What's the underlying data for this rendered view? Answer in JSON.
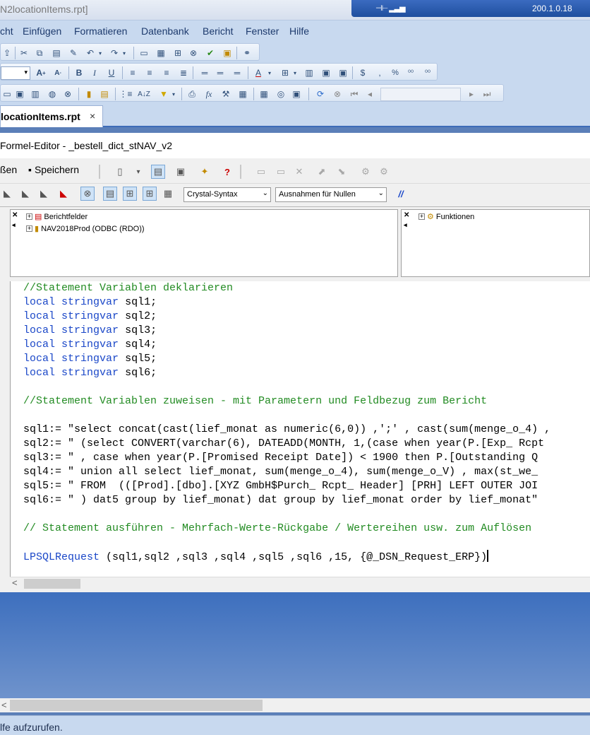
{
  "window": {
    "title": "N2locationItems.rpt]",
    "network_label": "200.1.0.18"
  },
  "menu": [
    "cht",
    "Einfügen",
    "Formatieren",
    "Datenbank",
    "Bericht",
    "Fenster",
    "Hilfe"
  ],
  "tab": {
    "label": "locationItems.rpt",
    "close": "×"
  },
  "editor": {
    "title": "Formel-Editor - _bestell_dict_stNAV_v2",
    "close_label": "ßen",
    "save_label": "Speichern",
    "syntax_select": "Crystal-Syntax",
    "null_select": "Ausnahmen für Nullen",
    "comment_toggle": "//"
  },
  "tree_left": [
    {
      "label": "Berichtfelder"
    },
    {
      "label": "NAV2018Prod (ODBC (RDO))"
    }
  ],
  "tree_right": [
    {
      "label": "Funktionen"
    }
  ],
  "code": {
    "c1": "//Statement Variablen deklarieren",
    "kw_local": "local",
    "kw_type": "stringvar",
    "v1": "sql1;",
    "v2": "sql2;",
    "v3": "sql3;",
    "v4": "sql4;",
    "v5": "sql5;",
    "v6": "sql6;",
    "c2": "//Statement Variablen zuweisen - mit Parametern und Feldbezug zum Bericht",
    "s1": "sql1:= \"select concat(cast(lief_monat as numeric(6,0)) ,';' , cast(sum(menge_o_4) ,",
    "s2": "sql2:= \" (select CONVERT(varchar(6), DATEADD(MONTH, 1,(case when year(P.[Exp_ Rcpt",
    "s3": "sql3:= \" , case when year(P.[Promised Receipt Date]) < 1900 then P.[Outstanding Q",
    "s4": "sql4:= \" union all select lief_monat, sum(menge_o_4), sum(menge_o_V) , max(st_we_",
    "s5": "sql5:= \" FROM  (([Prod].[dbo].[XYZ GmbH$Purch_ Rcpt_ Header] [PRH] LEFT OUTER JOI",
    "s6": "sql6:= \" ) dat5 group by lief_monat) dat group by lief_monat order by lief_monat\"",
    "c3": "// Statement ausführen - Mehrfach-Werte-Rückgabe / Wertereihen usw. zum Auflösen",
    "fn": "LPSQLRequest",
    "fn_args": " (sql1,sql2 ,sql3 ,sql4 ,sql5 ,sql6 ,15, {@_DSN_Request_ERP})"
  },
  "status": "lfe aufzurufen."
}
